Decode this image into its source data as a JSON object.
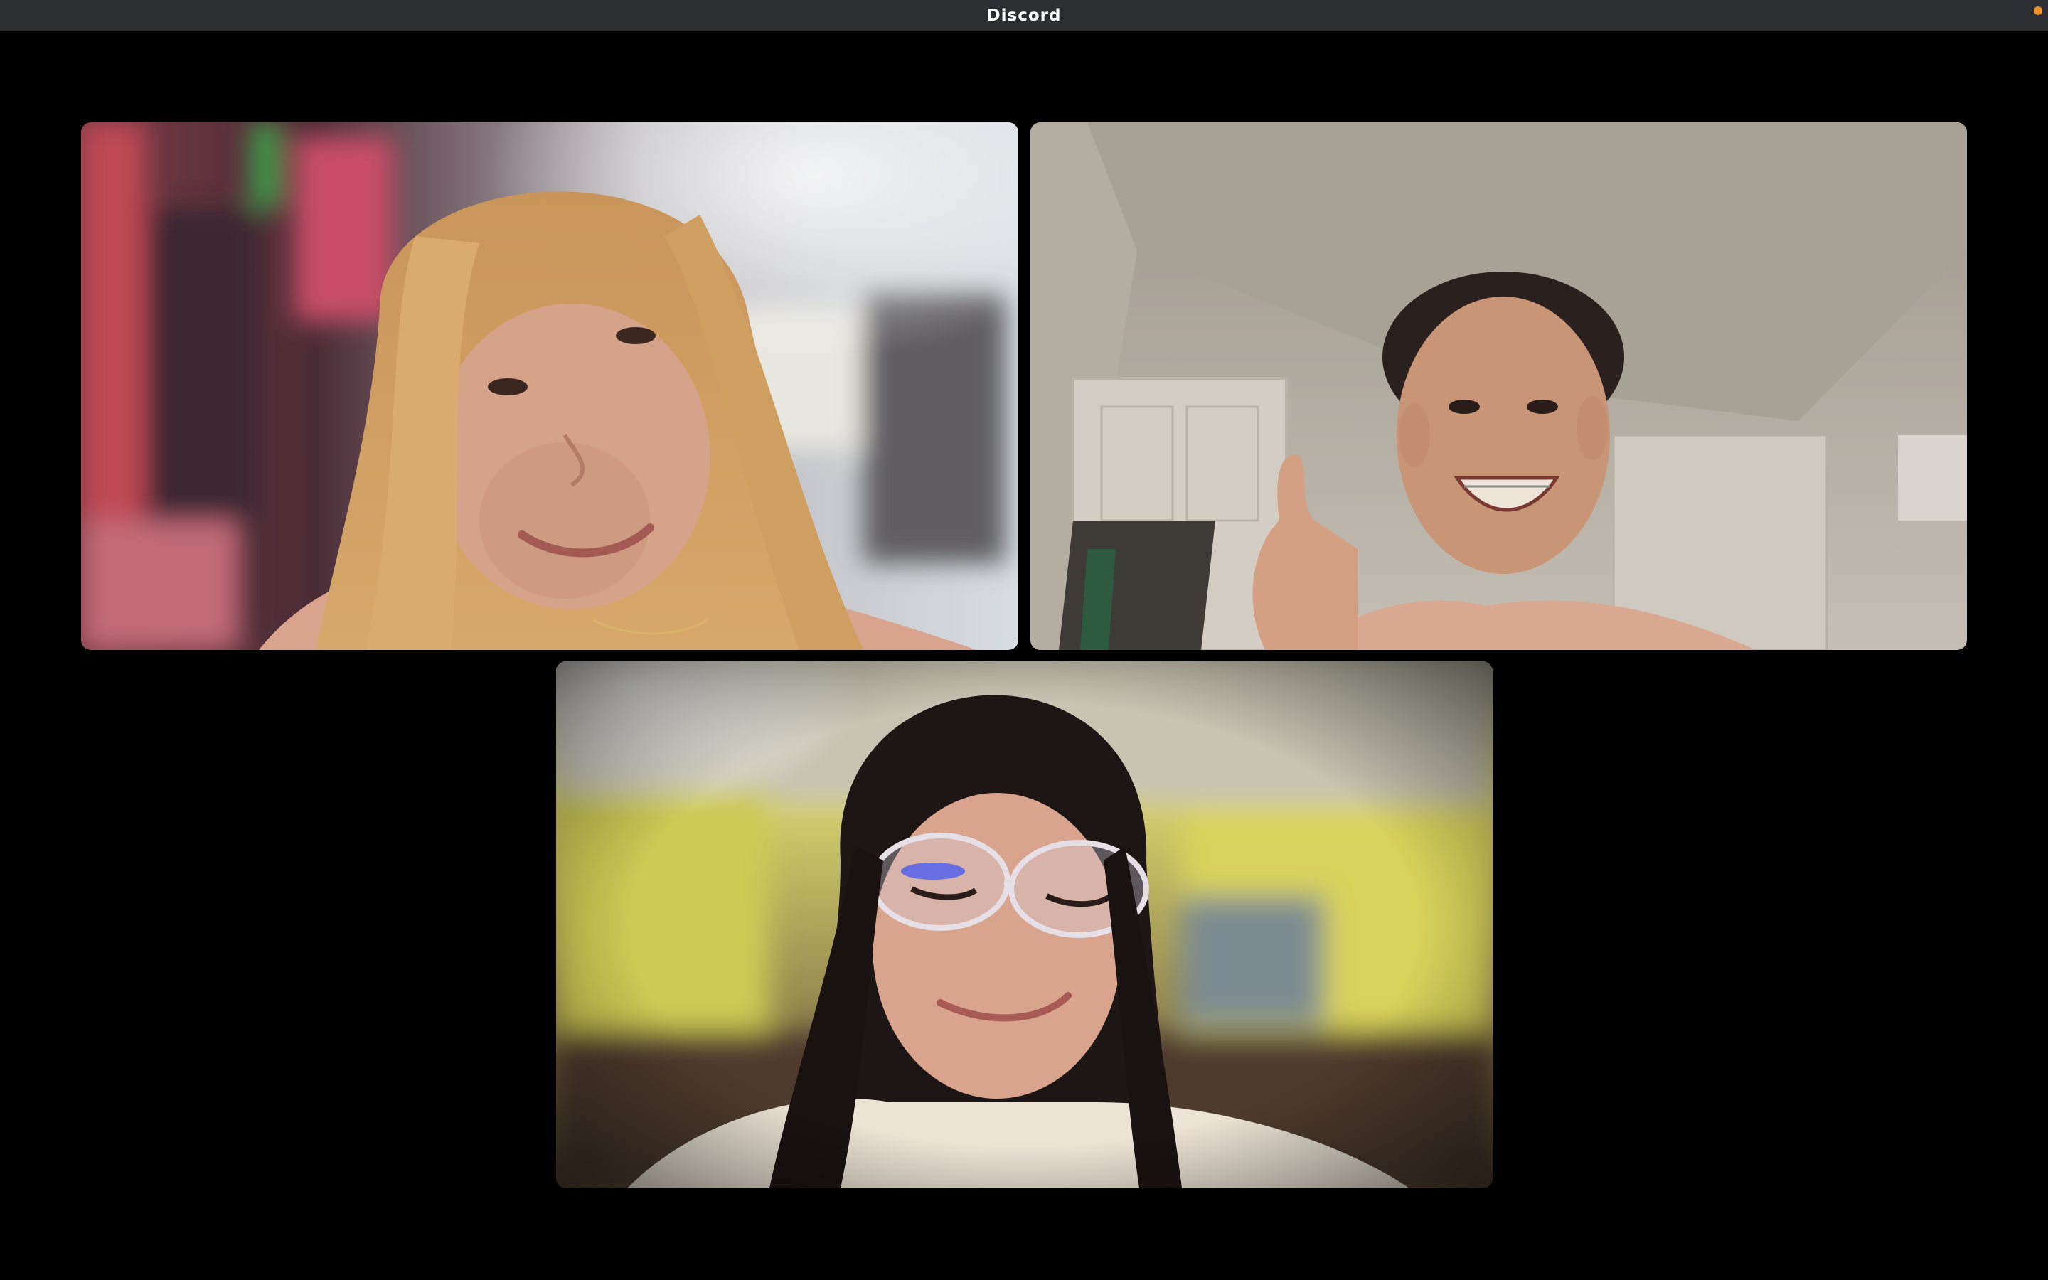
{
  "window": {
    "title": "Discord",
    "indicator_color": "#f0932b"
  },
  "call": {
    "participants": [
      {
        "tile": "video-tile-1"
      },
      {
        "tile": "video-tile-2"
      },
      {
        "tile": "video-tile-3"
      }
    ]
  }
}
